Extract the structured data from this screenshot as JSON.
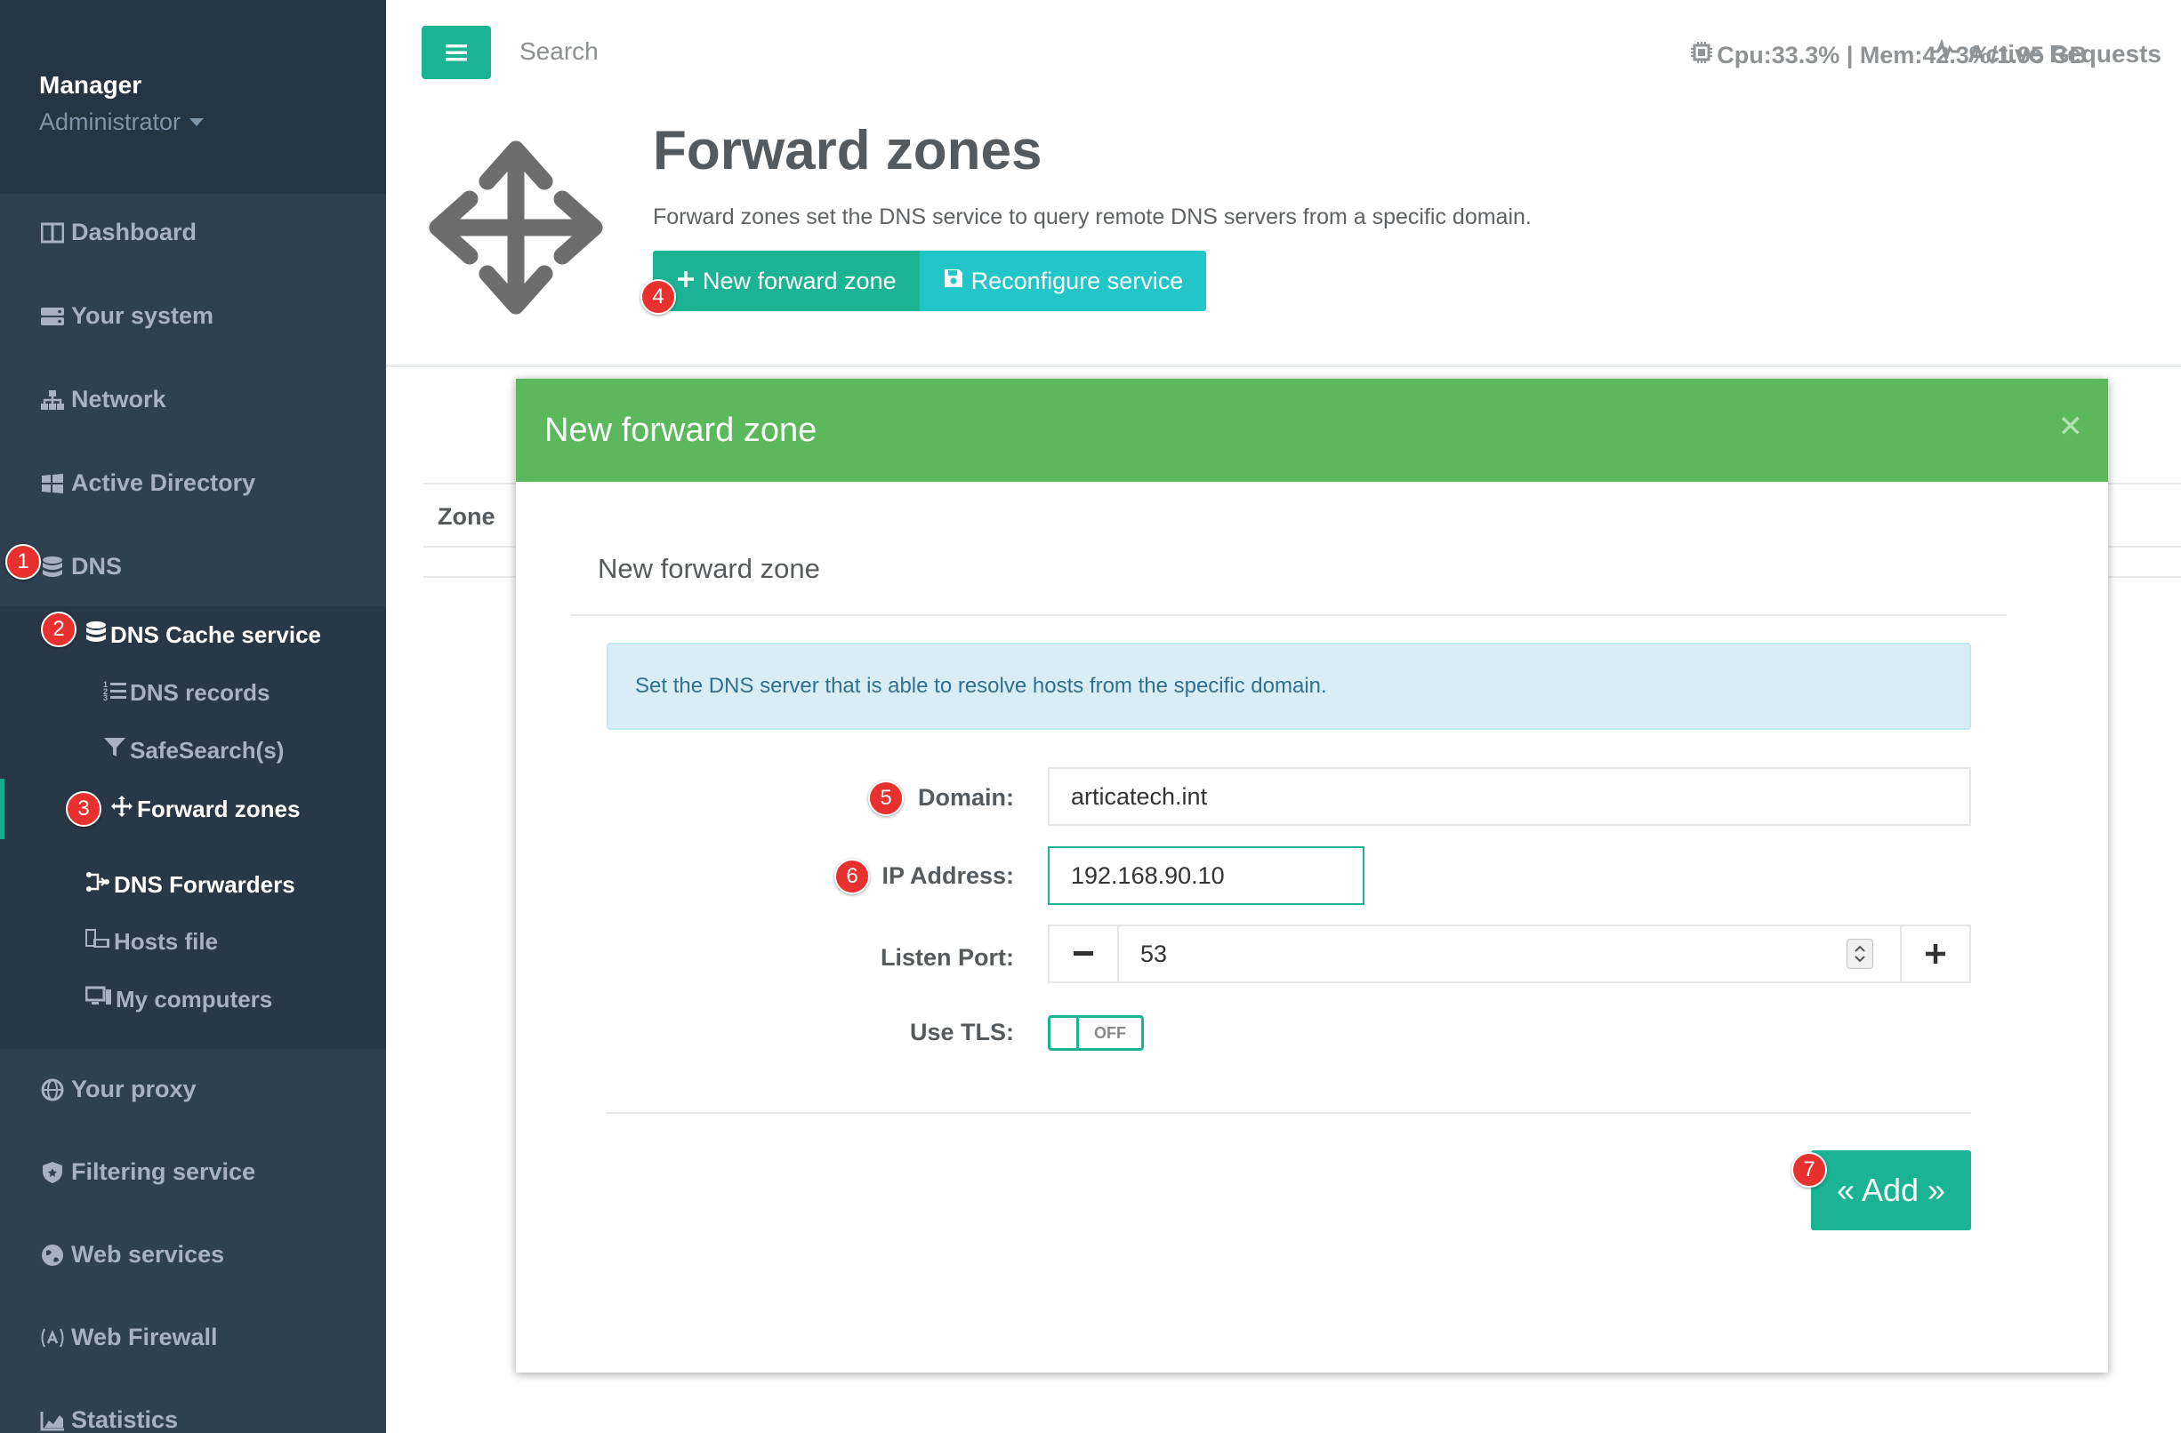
{
  "sidebar": {
    "user_name": "Manager",
    "user_role": "Administrator",
    "items": [
      {
        "label": "Dashboard",
        "icon": "dashboard-icon"
      },
      {
        "label": "Your system",
        "icon": "server-icon"
      },
      {
        "label": "Network",
        "icon": "sitemap-icon"
      },
      {
        "label": "Active Directory",
        "icon": "windows-icon"
      },
      {
        "label": "DNS",
        "icon": "database-icon"
      },
      {
        "label": "Your proxy",
        "icon": "globe-icon"
      },
      {
        "label": "Filtering service",
        "icon": "shield-icon"
      },
      {
        "label": "Web services",
        "icon": "globe-icon"
      },
      {
        "label": "Web Firewall",
        "icon": "firewall-icon"
      },
      {
        "label": "Statistics",
        "icon": "chart-icon"
      }
    ],
    "dns_submenu": [
      {
        "label": "DNS Cache service",
        "icon": "database-icon"
      },
      {
        "label": "DNS records",
        "icon": "list-ordered-icon"
      },
      {
        "label": "SafeSearch(s)",
        "icon": "filter-icon"
      },
      {
        "label": "Forward zones",
        "icon": "move-icon"
      },
      {
        "label": "DNS Forwarders",
        "icon": "forwarders-icon"
      },
      {
        "label": "Hosts file",
        "icon": "hosts-icon"
      },
      {
        "label": "My computers",
        "icon": "computers-icon"
      }
    ]
  },
  "topbar": {
    "search_placeholder": "Search",
    "stats": "Cpu:33.3% | Mem:42.3%/1.95 GB",
    "active_requests": "Active Requests"
  },
  "header": {
    "title": "Forward zones",
    "description": "Forward zones set the DNS service to query remote DNS servers from a specific domain.",
    "new_button": "New forward zone",
    "reconfigure_button": "Reconfigure service"
  },
  "table": {
    "columns": [
      "Zone"
    ]
  },
  "modal": {
    "title": "New forward zone",
    "section_title": "New forward zone",
    "info": "Set the DNS server that is able to resolve hosts from the specific domain.",
    "fields": {
      "domain_label": "Domain:",
      "domain_value": "articatech.int",
      "ip_label": "IP Address:",
      "ip_value": "192.168.90.10",
      "port_label": "Listen Port:",
      "port_value": "53",
      "tls_label": "Use TLS:",
      "tls_value": "OFF"
    },
    "add_button": "« Add »"
  },
  "annotations": [
    "1",
    "2",
    "3",
    "4",
    "5",
    "6",
    "7"
  ],
  "colors": {
    "sidebar_bg": "#2f4050",
    "primary": "#1ab394",
    "info": "#23c6c8",
    "modal_header": "#5cb85c",
    "badge": "#e8312f"
  }
}
